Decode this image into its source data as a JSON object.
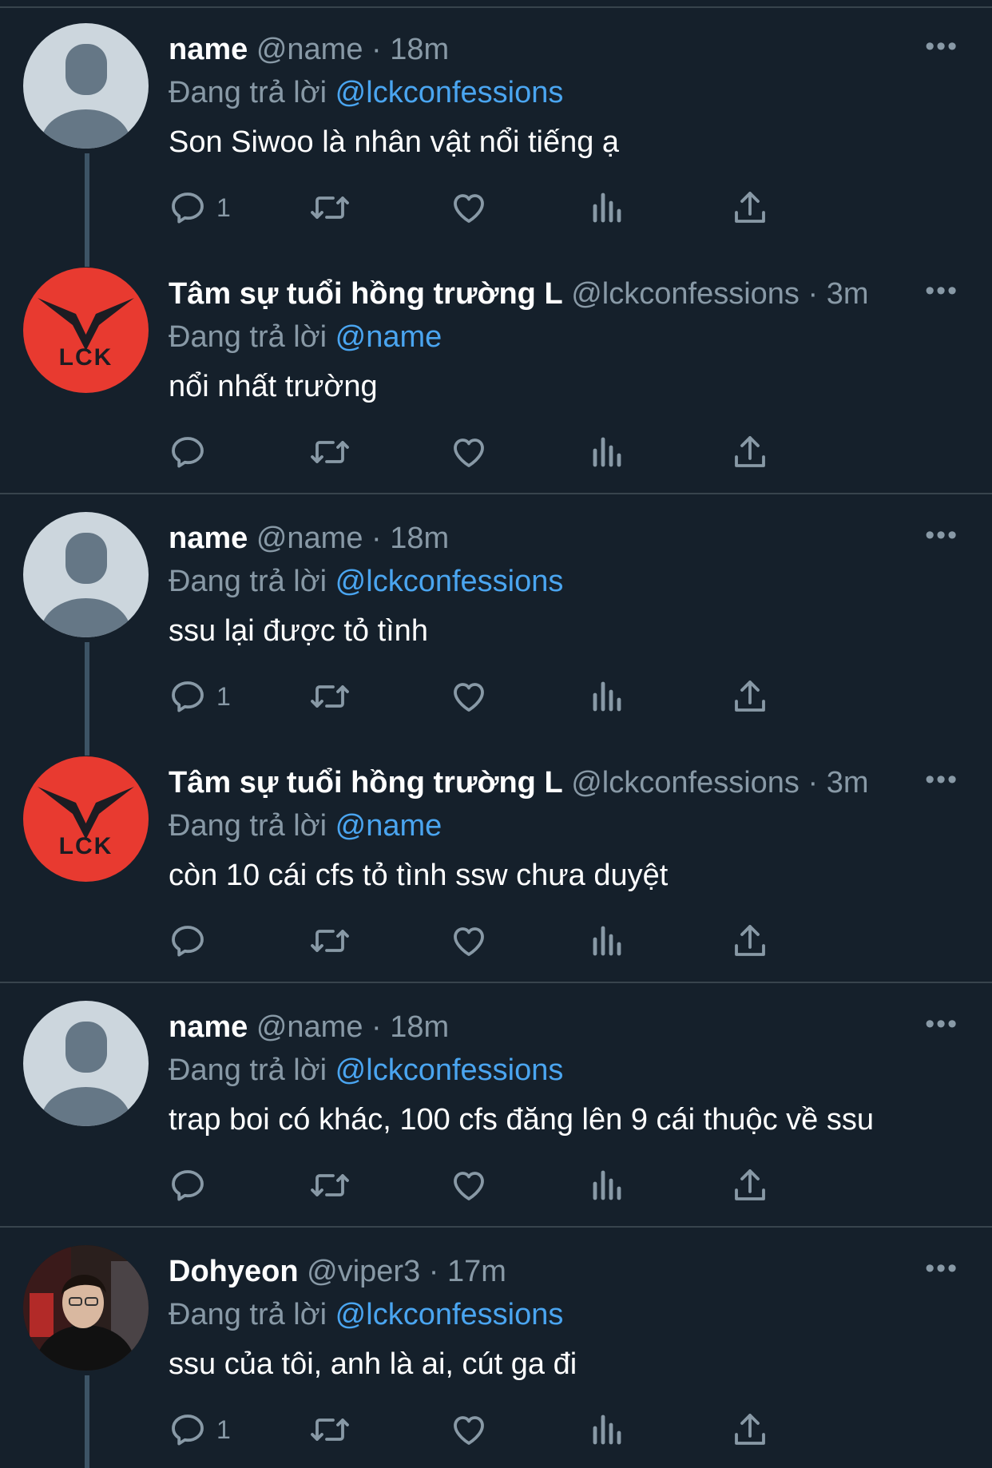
{
  "tweets": [
    {
      "avatar": "default-avatar",
      "display_name": "name",
      "handle": "@name",
      "dot": "·",
      "time": "18m",
      "reply_prefix": "Đang trả lời",
      "reply_to": "@lckconfessions",
      "text": "Son Siwoo là nhân vật nổi tiếng ạ",
      "reply_count": "1"
    },
    {
      "avatar": "lck-logo",
      "display_name": "Tâm sự tuổi hồng trường L",
      "handle": "@lckconfessions",
      "dot": "·",
      "time": "3m",
      "reply_prefix": "Đang trả lời",
      "reply_to": "@name",
      "text": "nổi nhất trường",
      "reply_count": ""
    },
    {
      "avatar": "default-avatar",
      "display_name": "name",
      "handle": "@name",
      "dot": "·",
      "time": "18m",
      "reply_prefix": "Đang trả lời",
      "reply_to": "@lckconfessions",
      "text": "ssu lại được tỏ tình",
      "reply_count": "1"
    },
    {
      "avatar": "lck-logo",
      "display_name": "Tâm sự tuổi hồng trường L",
      "handle": "@lckconfessions",
      "dot": "·",
      "time": "3m",
      "reply_prefix": "Đang trả lời",
      "reply_to": "@name",
      "text": "còn 10 cái cfs tỏ tình ssw chưa duyệt",
      "reply_count": ""
    },
    {
      "avatar": "default-avatar",
      "display_name": "name",
      "handle": "@name",
      "dot": "·",
      "time": "18m",
      "reply_prefix": "Đang trả lời",
      "reply_to": "@lckconfessions",
      "text": "trap boi có khác, 100 cfs đăng lên 9 cái thuộc về ssu",
      "reply_count": ""
    },
    {
      "avatar": "photo-avatar",
      "display_name": "Dohyeon",
      "handle": "@viper3",
      "dot": "·",
      "time": "17m",
      "reply_prefix": "Đang trả lời",
      "reply_to": "@lckconfessions",
      "text": "ssu của tôi, anh là ai, cút ga đi",
      "reply_count": "1"
    }
  ],
  "avatar_logo_text": "LCK",
  "more_glyph": "•••",
  "icons": [
    "reply-icon",
    "retweet-icon",
    "like-icon",
    "analytics-icon",
    "share-icon"
  ],
  "colors": {
    "background": "#15202b",
    "secondary_text": "#8899a6",
    "link": "#4aa5f0",
    "divider": "#38444d",
    "lck_red": "#e83a30"
  }
}
